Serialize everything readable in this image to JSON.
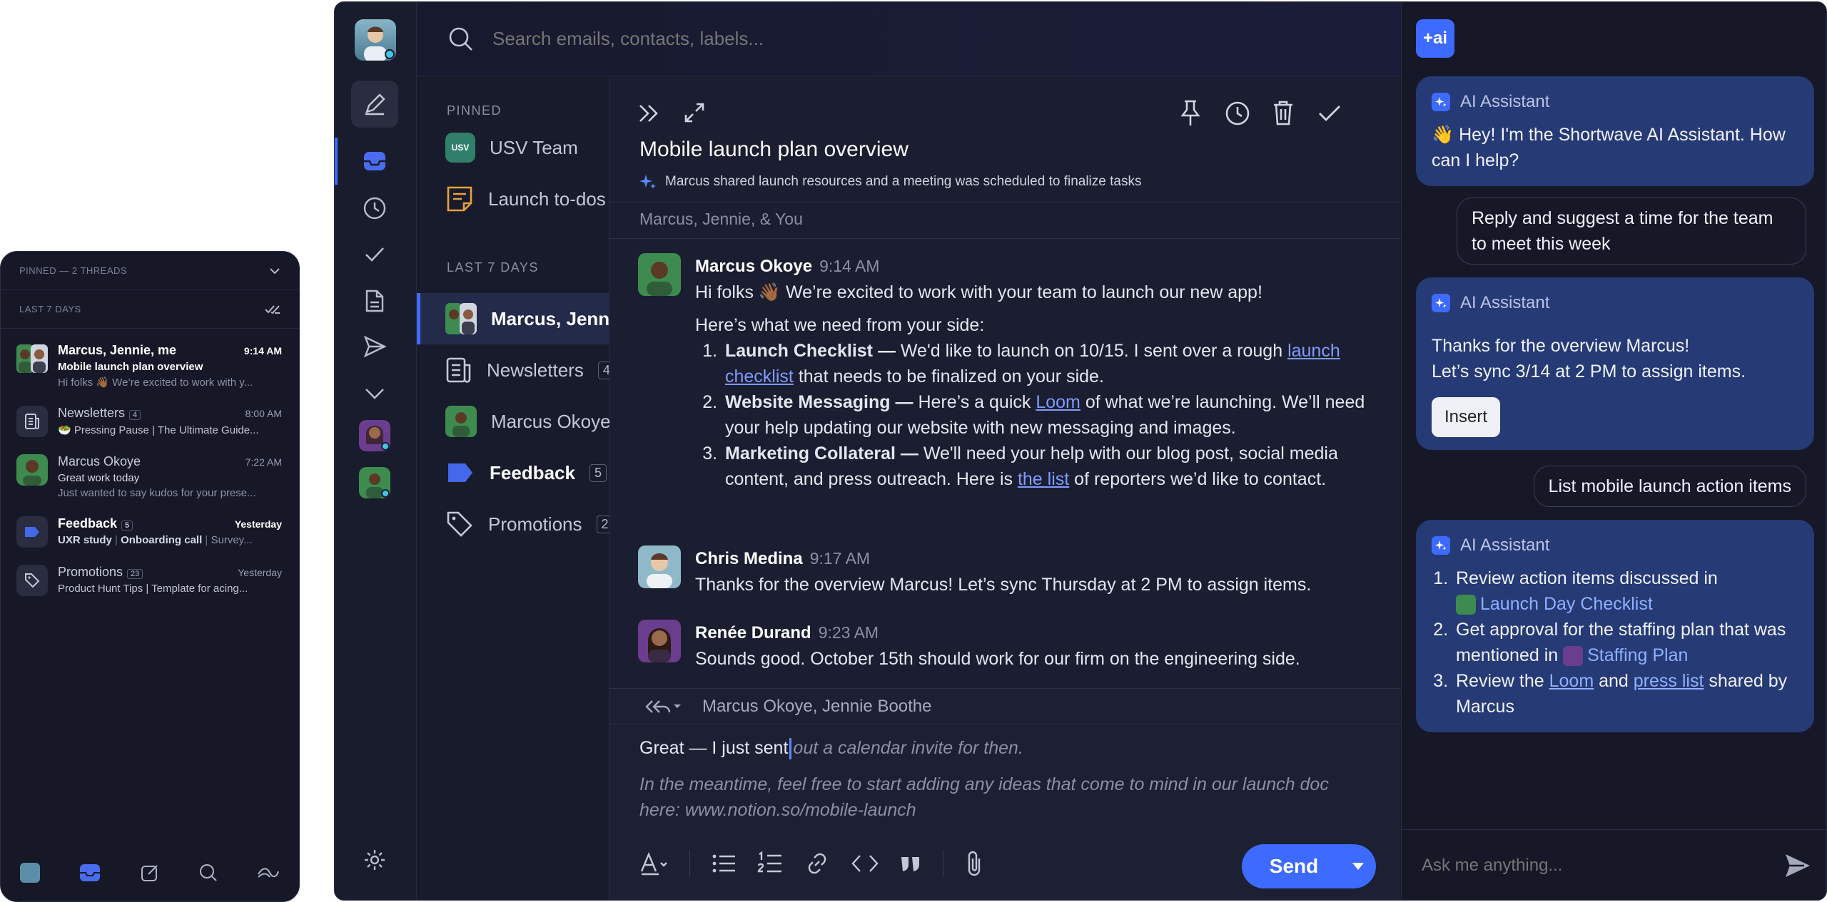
{
  "mobile": {
    "pinned_label": "PINNED — 2 THREADS",
    "last7_label": "LAST 7 DAYS",
    "threads": [
      {
        "title": "Marcus, Jennie, me",
        "time": "9:14 AM",
        "subject": "Mobile launch plan overview",
        "preview": "Hi folks 👋🏾 We’re excited to work with y..."
      },
      {
        "title": "Newsletters",
        "count": "4",
        "time": "8:00 AM",
        "preview": "🥗 Pressing Pause  |  The Ultimate Guide..."
      },
      {
        "title": "Marcus Okoye",
        "time": "7:22 AM",
        "subject": "Great work today",
        "preview": "Just wanted to say kudos for your prese..."
      },
      {
        "title": "Feedback",
        "count": "5",
        "time": "Yesterday",
        "tag1": "UXR study",
        "tag2": "Onboarding call",
        "tag3": "Survey..."
      },
      {
        "title": "Promotions",
        "count": "23",
        "time": "Yesterday",
        "preview": "Product Hunt Tips  |  Template for acing..."
      }
    ]
  },
  "search": {
    "placeholder": "Search emails, contacts, labels..."
  },
  "sidebar": {
    "pinned_label": "PINNED",
    "last7_label": "LAST 7 DAYS",
    "usv_badge": "USV",
    "items": [
      {
        "label": "USV Team"
      },
      {
        "label": "Launch to-dos"
      },
      {
        "label": "Marcus, Jennie"
      },
      {
        "label": "Newsletters",
        "count": "4"
      },
      {
        "label": "Marcus Okoye"
      },
      {
        "label": "Feedback",
        "count": "5"
      },
      {
        "label": "Promotions",
        "count": "2"
      }
    ]
  },
  "thread": {
    "title": "Mobile launch plan overview",
    "summary": "Marcus shared launch resources and a meeting was scheduled to finalize tasks",
    "participants": "Marcus, Jennie, & You",
    "messages": [
      {
        "name": "Marcus Okoye",
        "time": "9:14 AM",
        "intro": "Hi folks 👋🏾 We’re excited to work with your team to launch our new app!",
        "need": "Here’s what we need from your side:",
        "item1_b": "Launch Checklist —",
        "item1_a": " We'd like to launch on 10/15. I sent over a rough ",
        "item1_link": "launch checklist",
        "item1_c": " that needs to be finalized on your side.",
        "item2_b": "Website Messaging —",
        "item2_a": " Here’s a quick ",
        "item2_link": "Loom",
        "item2_c": " of what we’re launching. We’ll need your help updating our website with new messaging and images.",
        "item3_b": "Marketing Collateral —",
        "item3_a": " We'll need your help with our blog post, social media content, and press outreach. Here is ",
        "item3_link": "the list",
        "item3_c": " of reporters we’d like to contact."
      },
      {
        "name": "Chris Medina",
        "time": "9:17 AM",
        "text": "Thanks for the overview Marcus! Let’s sync Thursday at 2 PM to assign items."
      },
      {
        "name": "Renée Durand",
        "time": "9:23 AM",
        "text": "Sounds good. October 15th should work for our firm on the engineering side."
      }
    ],
    "reply_to": "Marcus Okoye, Jennie Boothe",
    "draft_typed": "Great — I just sent",
    "draft_suggest1": "out a calendar invite for then.",
    "draft_suggest2": "In the meantime, feel free to start adding any ideas that come to mind in our launch doc here: www.notion.so/mobile-launch",
    "send_label": "Send"
  },
  "ai": {
    "logo": "+ai",
    "assistant_name": "AI Assistant",
    "greeting": "👋 Hey! I'm the Shortwave AI Assistant. How can I help?",
    "user1": "Reply and suggest a time for the team to meet this week",
    "reply1_line1": "Thanks for the overview Marcus!",
    "reply1_line2": "Let’s sync 3/14 at 2 PM to assign items.",
    "insert_label": "Insert",
    "user2": "List mobile launch action items",
    "list1_a": "Review action items discussed in",
    "list1_link": "Launch Day Checklist",
    "list2_a": "Get approval for the staffing plan that was mentioned in",
    "list2_link": "Staffing Plan",
    "list3_a": "Review the ",
    "list3_link1": "Loom",
    "list3_mid": " and ",
    "list3_link2": "press list",
    "list3_c": " shared by Marcus",
    "input_placeholder": "Ask me anything..."
  },
  "colors": {
    "accent": "#3d6bff",
    "bg": "#141726",
    "bubble": "#263a75"
  }
}
